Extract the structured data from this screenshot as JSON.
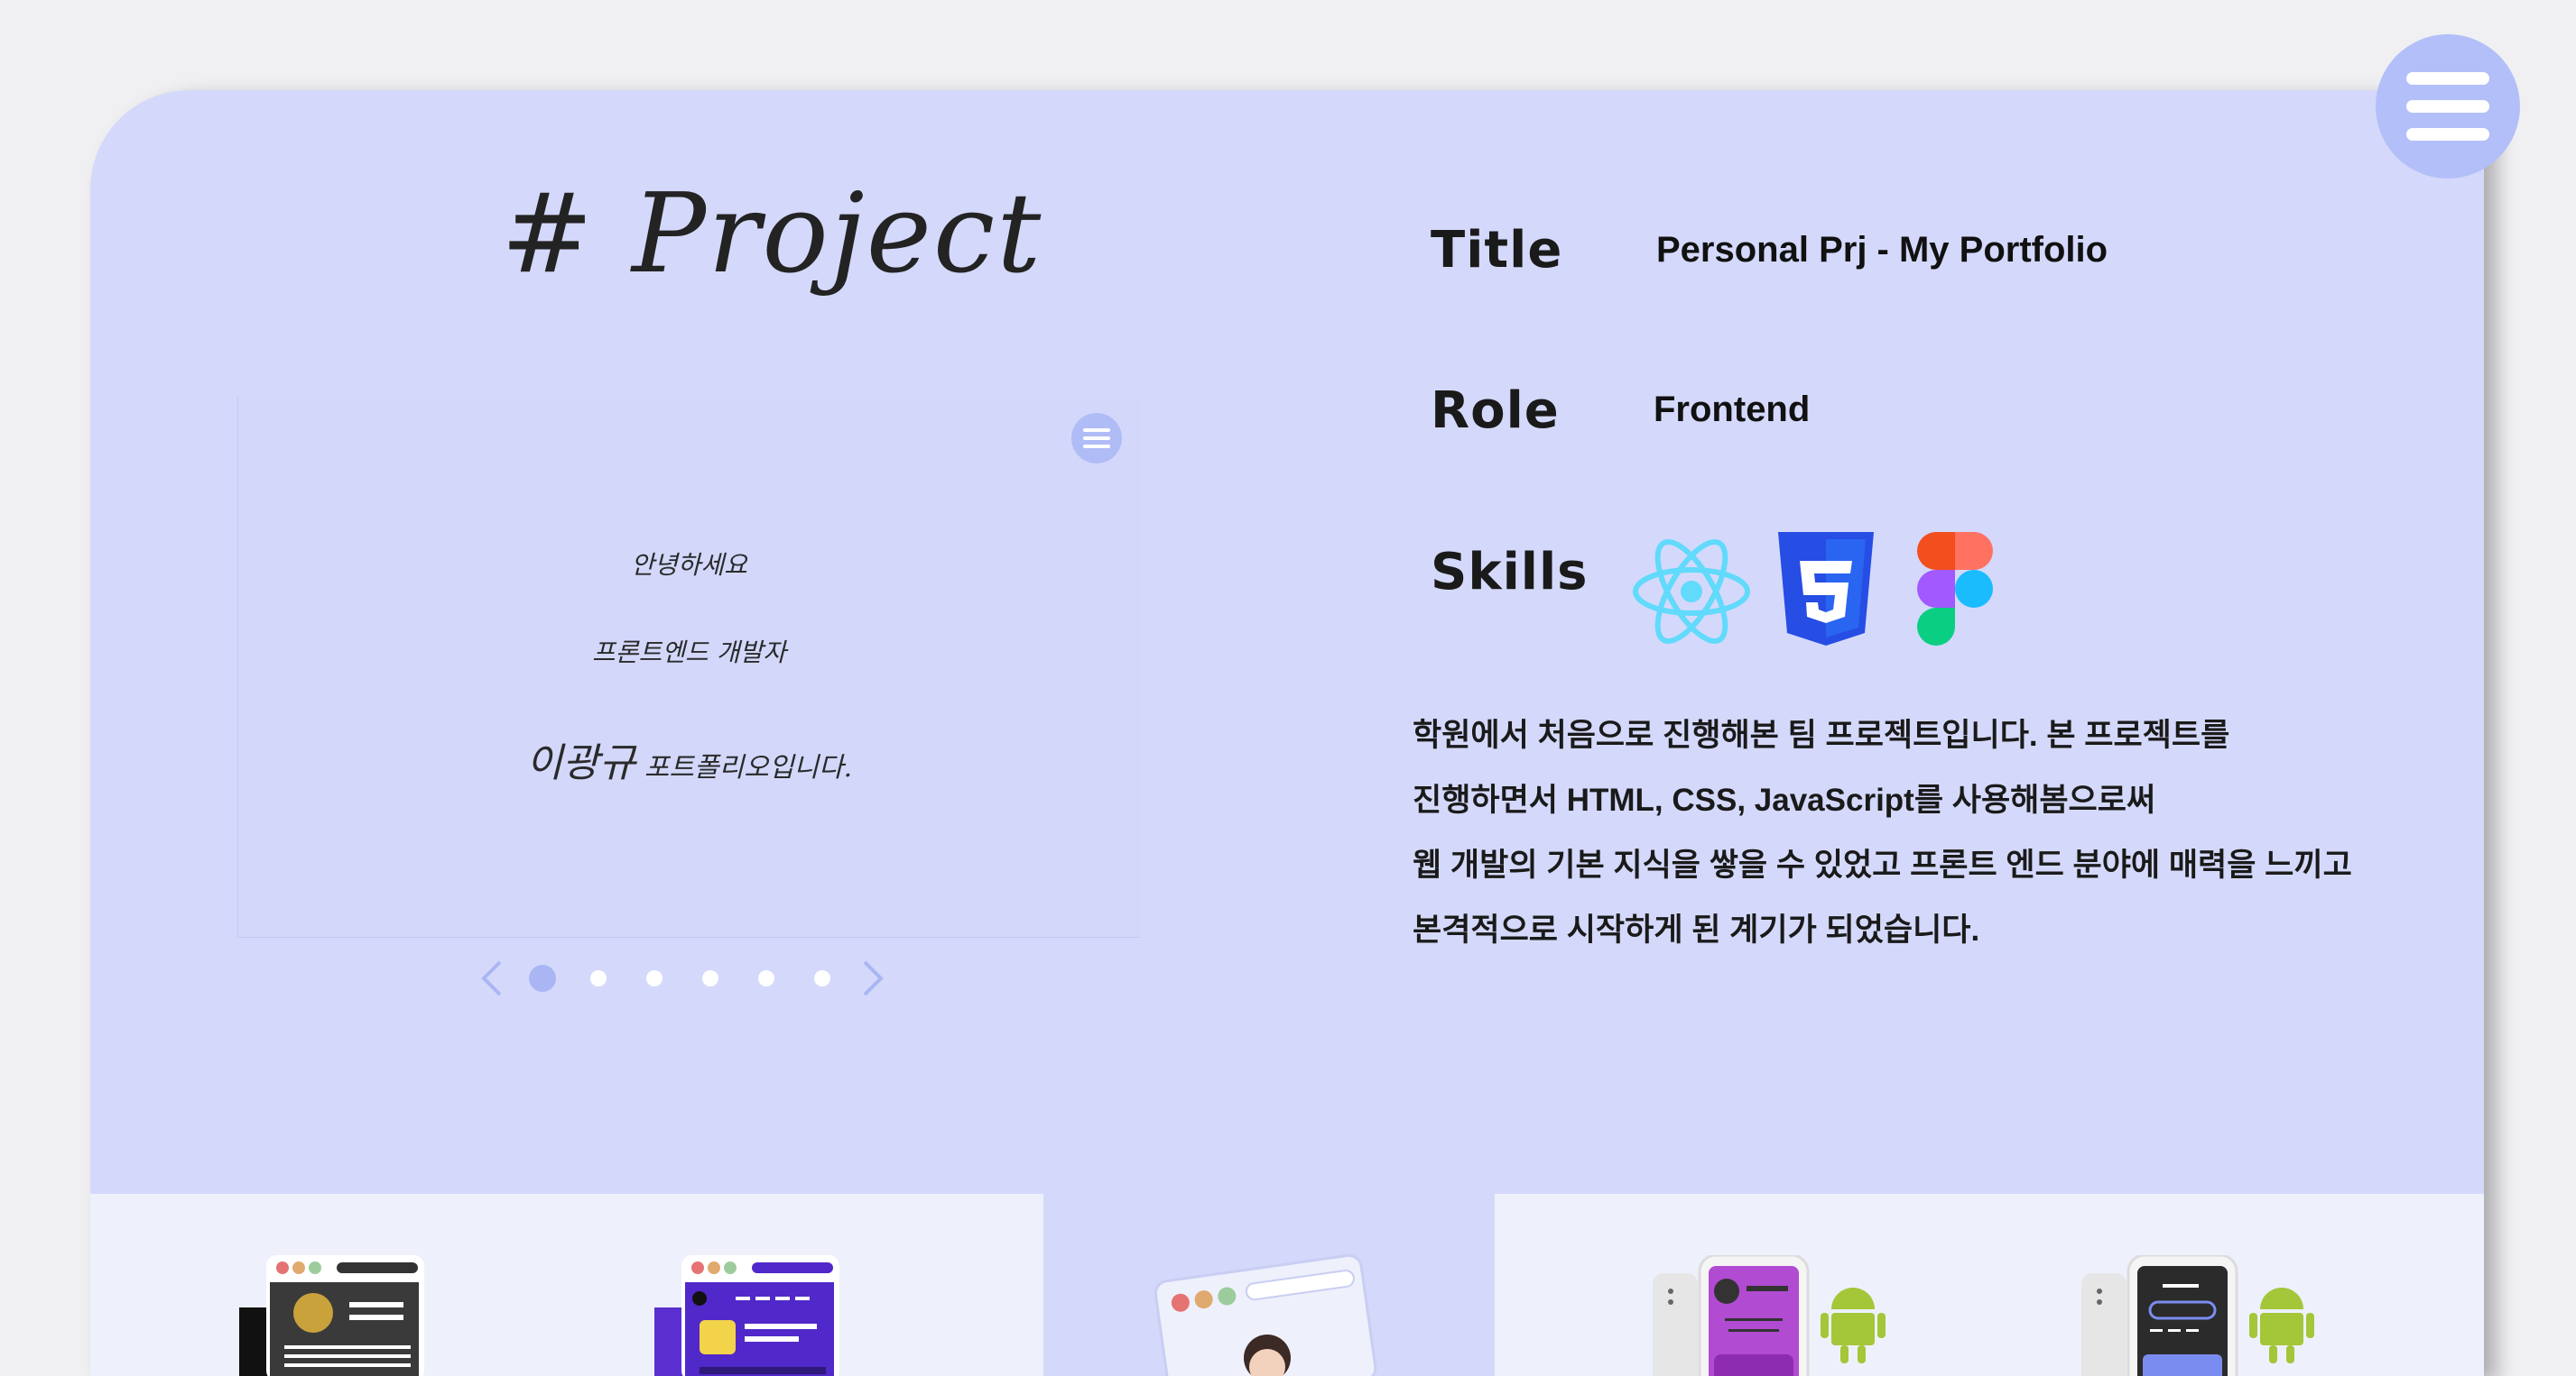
{
  "page": {
    "heading": "# Project"
  },
  "slide": {
    "line1": "안녕하세요",
    "line2": "프론트엔드 개발자",
    "line3_name": "이광규",
    "line3_rest": " 포트폴리오입니다.",
    "dot_count": 6,
    "active_dot": 0
  },
  "info": {
    "title_label": "Title",
    "title_value": "Personal Prj - My Portfolio",
    "role_label": "Role",
    "role_value": "Frontend",
    "skills_label": "Skills",
    "skills": [
      "react-icon",
      "css3-icon",
      "figma-icon"
    ]
  },
  "description": [
    "학원에서 처음으로 진행해본 팀 프로젝트입니다. 본 프로젝트를",
    "진행하면서 HTML, CSS, JavaScript를 사용해봄으로써",
    "웹 개발의 기본 지식을 쌓을 수 있었고 프론트 엔드 분야에 매력을 느끼고",
    "본격적으로 시작하게 된 계기가 되었습니다."
  ],
  "colors": {
    "card_bg": "#d4d9fb",
    "accent": "#aab6f4",
    "react": "#61dafb",
    "css3": "#264de4",
    "android": "#a4c639"
  }
}
